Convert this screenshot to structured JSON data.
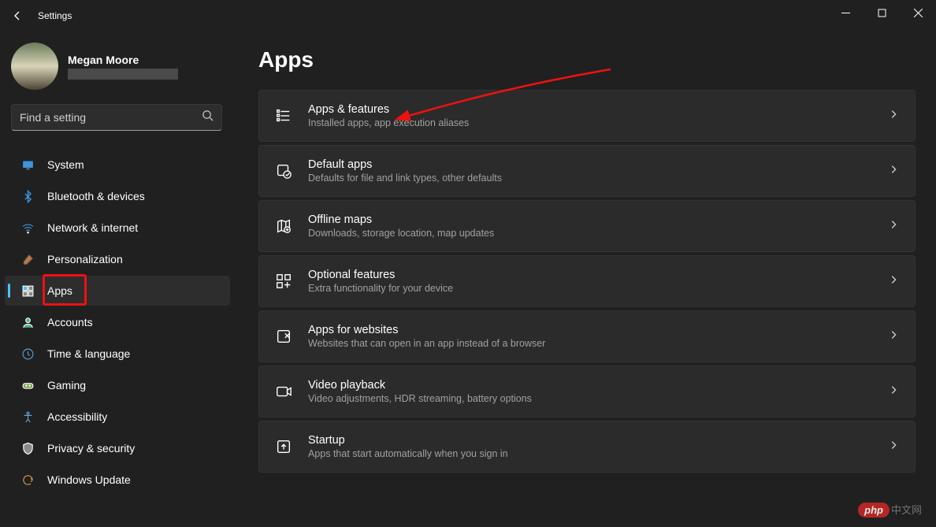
{
  "window": {
    "title": "Settings"
  },
  "user": {
    "name": "Megan Moore"
  },
  "search": {
    "placeholder": "Find a setting"
  },
  "sidebar": {
    "items": [
      {
        "label": "System",
        "icon": "system"
      },
      {
        "label": "Bluetooth & devices",
        "icon": "bluetooth"
      },
      {
        "label": "Network & internet",
        "icon": "wifi"
      },
      {
        "label": "Personalization",
        "icon": "brush"
      },
      {
        "label": "Apps",
        "icon": "apps",
        "active": true,
        "highlight": true
      },
      {
        "label": "Accounts",
        "icon": "account"
      },
      {
        "label": "Time & language",
        "icon": "clock"
      },
      {
        "label": "Gaming",
        "icon": "gaming"
      },
      {
        "label": "Accessibility",
        "icon": "accessibility"
      },
      {
        "label": "Privacy & security",
        "icon": "shield"
      },
      {
        "label": "Windows Update",
        "icon": "update"
      }
    ]
  },
  "page": {
    "title": "Apps",
    "items": [
      {
        "title": "Apps & features",
        "subtitle": "Installed apps, app execution aliases",
        "icon": "list",
        "arrow": true
      },
      {
        "title": "Default apps",
        "subtitle": "Defaults for file and link types, other defaults",
        "icon": "default"
      },
      {
        "title": "Offline maps",
        "subtitle": "Downloads, storage location, map updates",
        "icon": "map"
      },
      {
        "title": "Optional features",
        "subtitle": "Extra functionality for your device",
        "icon": "optional"
      },
      {
        "title": "Apps for websites",
        "subtitle": "Websites that can open in an app instead of a browser",
        "icon": "website"
      },
      {
        "title": "Video playback",
        "subtitle": "Video adjustments, HDR streaming, battery options",
        "icon": "video"
      },
      {
        "title": "Startup",
        "subtitle": "Apps that start automatically when you sign in",
        "icon": "startup"
      }
    ]
  },
  "watermark": {
    "brand": "php",
    "suffix": "中文网"
  }
}
